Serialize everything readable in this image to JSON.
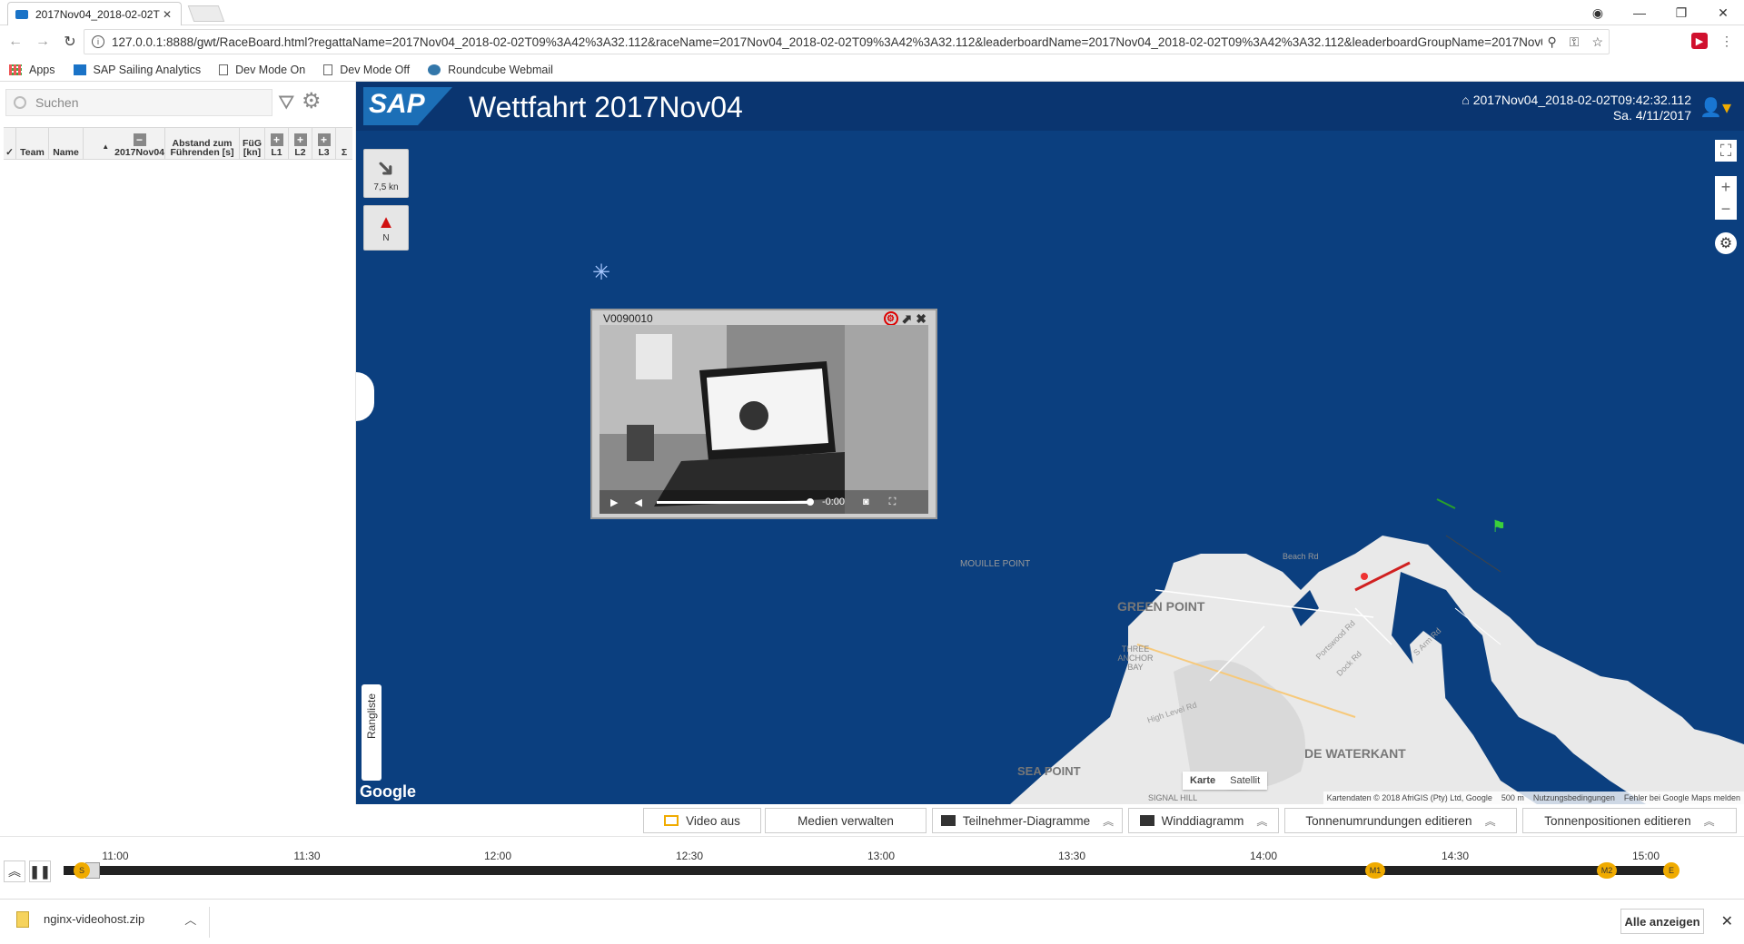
{
  "browser": {
    "tab_title": "2017Nov04_2018-02-02T",
    "url": "127.0.0.1:8888/gwt/RaceBoard.html?regattaName=2017Nov04_2018-02-02T09%3A42%3A32.112&raceName=2017Nov04_2018-02-02T09%3A42%3A32.112&leaderboardName=2017Nov04_2018-02-02T09%3A42%3A32.112&leaderboardGroupName=2017Nov04_2...",
    "bookmarks": [
      "Apps",
      "SAP Sailing Analytics",
      "Dev Mode On",
      "Dev Mode Off",
      "Roundcube Webmail"
    ]
  },
  "leftpanel": {
    "search_placeholder": "Suchen",
    "columns": {
      "check": "✓",
      "team": "Team",
      "name": "Name",
      "race": "2017Nov04",
      "gap": "Abstand zum Führenden [s]",
      "speed": "FüG [kn]",
      "l1": "L1",
      "l2": "L2",
      "l3": "L3",
      "sum": "Σ"
    }
  },
  "header": {
    "logo": "SAP",
    "title": "Wettfahrt 2017Nov04",
    "race_id": "2017Nov04_2018-02-02T09:42:32.112",
    "date": "Sa. 4/11/2017"
  },
  "map": {
    "wind_speed": "7,5 kn",
    "north_label": "N",
    "rangliste": "Rangliste",
    "google": "Google",
    "map_type": [
      "Karte",
      "Satellit"
    ],
    "attribution": "Kartendaten © 2018 AfriGIS (Pty) Ltd, Google",
    "scale": "500 m",
    "terms": "Nutzungsbedingungen",
    "report": "Fehler bei Google Maps melden",
    "labels": [
      "MOUILLE POINT",
      "GREEN POINT",
      "THREE ANCHOR BAY",
      "SEA POINT",
      "DE WATERKANT",
      "SIGNAL HILL",
      "Beach Rd",
      "High Level Rd",
      "Portswood Rd",
      "Dock Rd",
      "S Arm Rd"
    ]
  },
  "video": {
    "title": "V0090010",
    "time": "-0:00",
    "progress": 1.0
  },
  "toolbar": {
    "video_off": "Video aus",
    "media": "Medien verwalten",
    "participants": "Teilnehmer-Diagramme",
    "wind": "Winddiagramm",
    "rounding": "Tonnenumrundungen editieren",
    "positions": "Tonnenpositionen editieren"
  },
  "timeline": {
    "times": [
      "11:00",
      "11:30",
      "12:00",
      "12:30",
      "13:00",
      "13:30",
      "14:00",
      "14:30",
      "15:00"
    ],
    "markers": [
      "S",
      "M1",
      "M2",
      "E"
    ]
  },
  "downloads": {
    "file": "nginx-videohost.zip",
    "show_all": "Alle anzeigen"
  },
  "colors": {
    "sea": "#0b3f7f",
    "header": "#0a3570",
    "accent": "#f0ab00"
  }
}
